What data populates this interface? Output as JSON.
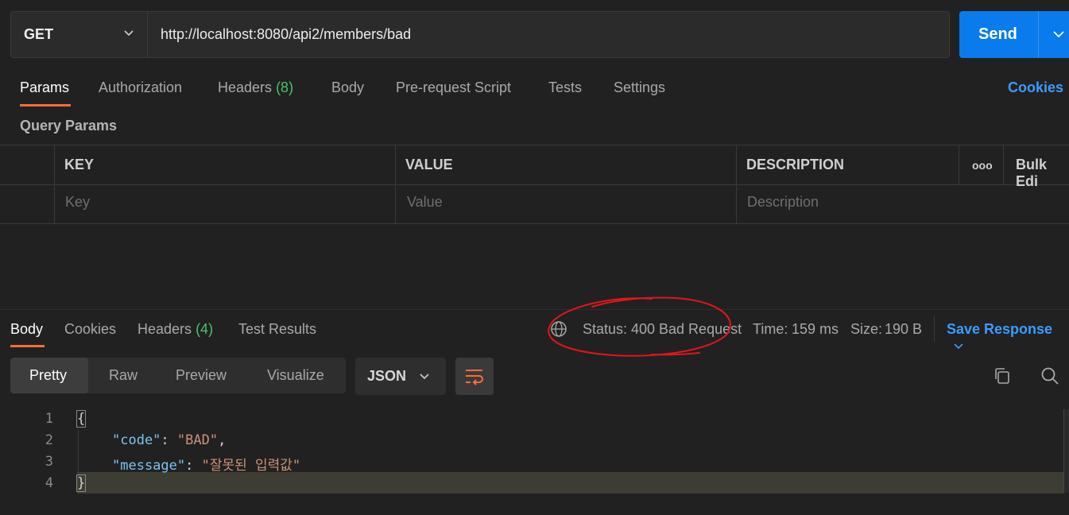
{
  "request": {
    "method": "GET",
    "url": "http://localhost:8080/api2/members/bad",
    "send_label": "Send"
  },
  "request_tabs": {
    "params": "Params",
    "authorization": "Authorization",
    "headers": "Headers",
    "headers_count": "(8)",
    "body": "Body",
    "pre_request": "Pre-request Script",
    "tests": "Tests",
    "settings": "Settings",
    "cookies": "Cookies"
  },
  "query_params": {
    "title": "Query Params",
    "columns": {
      "key": "KEY",
      "value": "VALUE",
      "description": "DESCRIPTION",
      "bulk_edit": "Bulk Edi",
      "more": "ooo"
    },
    "placeholders": {
      "key": "Key",
      "value": "Value",
      "description": "Description"
    }
  },
  "response": {
    "tabs": {
      "body": "Body",
      "cookies": "Cookies",
      "headers": "Headers",
      "headers_count": "(4)",
      "test_results": "Test Results"
    },
    "status_label": "Status:",
    "status_value": "400 Bad Request",
    "time_label": "Time:",
    "time_value": "159 ms",
    "size_label": "Size:",
    "size_value": "190 B",
    "save_label": "Save Response",
    "view_modes": [
      "Pretty",
      "Raw",
      "Preview",
      "Visualize"
    ],
    "format": "JSON",
    "code": {
      "line_numbers": [
        "1",
        "2",
        "3",
        "4"
      ],
      "open_brace": "{",
      "close_brace": "}",
      "code_key": "\"code\"",
      "code_value": "\"BAD\"",
      "message_key": "\"message\"",
      "message_value": "\"잘못된 입력값\""
    }
  },
  "colors": {
    "background": "#212121",
    "accent_orange": "#ff6c37",
    "send_blue": "#097bed",
    "link_blue": "#3b9cff",
    "success_green": "#49c36b",
    "annotation_red": "#e0161b"
  },
  "icons": [
    "chevron-down-icon",
    "globe-icon",
    "wrap-lines-icon",
    "copy-icon",
    "search-icon"
  ]
}
